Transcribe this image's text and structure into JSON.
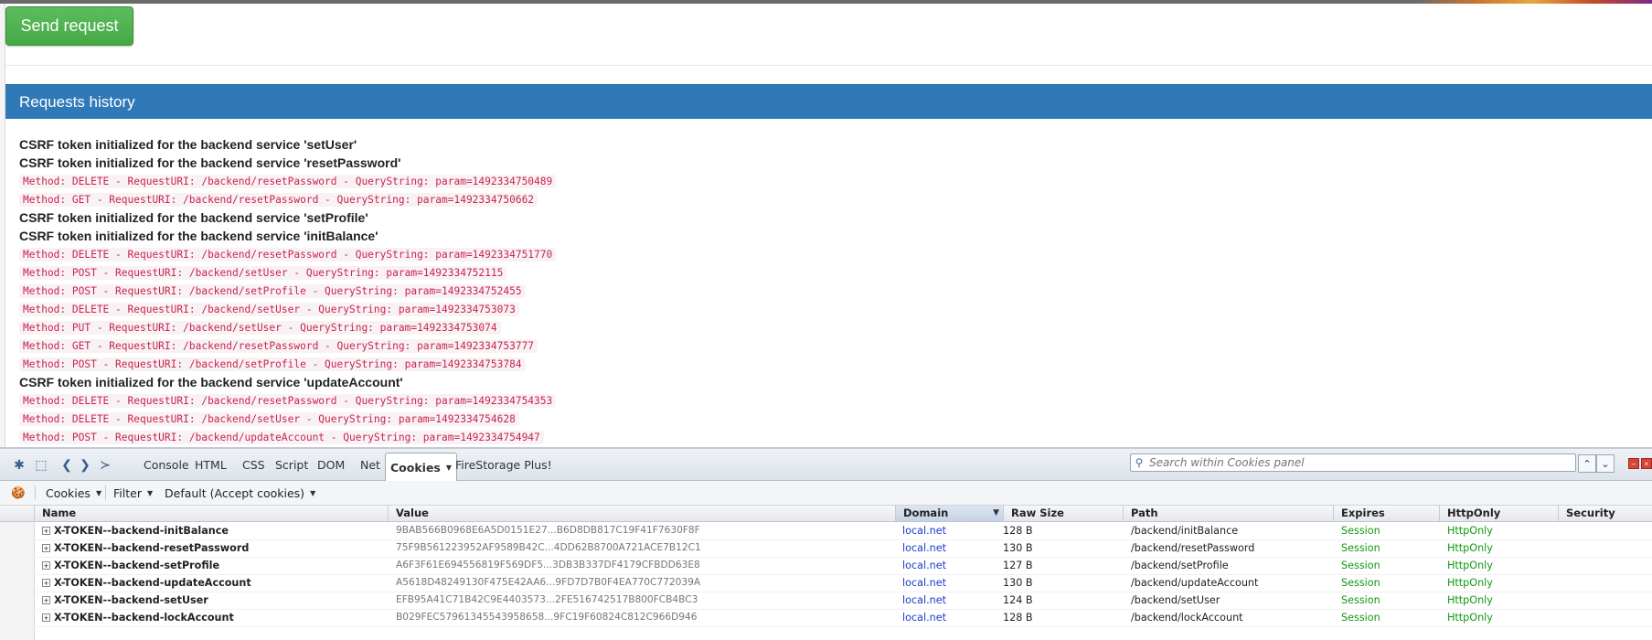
{
  "send_button": {
    "label": "Send request",
    "color": "#4cae4c"
  },
  "history": {
    "title": "Requests history",
    "header_color": "#3079b8",
    "entries": [
      {
        "kind": "csrf",
        "text": "CSRF token initialized for the backend service 'setUser'"
      },
      {
        "kind": "csrf",
        "text": "CSRF token initialized for the backend service 'resetPassword'"
      },
      {
        "kind": "req",
        "text": "Method: DELETE - RequestURI: /backend/resetPassword - QueryString: param=1492334750489"
      },
      {
        "kind": "req",
        "text": "Method: GET - RequestURI: /backend/resetPassword - QueryString: param=1492334750662"
      },
      {
        "kind": "csrf",
        "text": "CSRF token initialized for the backend service 'setProfile'"
      },
      {
        "kind": "csrf",
        "text": "CSRF token initialized for the backend service 'initBalance'"
      },
      {
        "kind": "req",
        "text": "Method: DELETE - RequestURI: /backend/resetPassword - QueryString: param=1492334751770"
      },
      {
        "kind": "req",
        "text": "Method: POST - RequestURI: /backend/setUser - QueryString: param=1492334752115"
      },
      {
        "kind": "req",
        "text": "Method: POST - RequestURI: /backend/setProfile - QueryString: param=1492334752455"
      },
      {
        "kind": "req",
        "text": "Method: DELETE - RequestURI: /backend/setUser - QueryString: param=1492334753073"
      },
      {
        "kind": "req",
        "text": "Method: PUT - RequestURI: /backend/setUser - QueryString: param=1492334753074"
      },
      {
        "kind": "req",
        "text": "Method: GET - RequestURI: /backend/resetPassword - QueryString: param=1492334753777"
      },
      {
        "kind": "req",
        "text": "Method: POST - RequestURI: /backend/setProfile - QueryString: param=1492334753784"
      },
      {
        "kind": "csrf",
        "text": "CSRF token initialized for the backend service 'updateAccount'"
      },
      {
        "kind": "req",
        "text": "Method: DELETE - RequestURI: /backend/resetPassword - QueryString: param=1492334754353"
      },
      {
        "kind": "req",
        "text": "Method: DELETE - RequestURI: /backend/setUser - QueryString: param=1492334754628"
      },
      {
        "kind": "req",
        "text": "Method: POST - RequestURI: /backend/updateAccount - QueryString: param=1492334754947"
      }
    ]
  },
  "firebug": {
    "tools": [
      {
        "name": "firebug-menu-icon",
        "glyph": "✱"
      },
      {
        "name": "inspect-icon",
        "glyph": "⬚"
      },
      {
        "name": "back-icon",
        "glyph": "❮"
      },
      {
        "name": "forward-icon",
        "glyph": "❯"
      },
      {
        "name": "command-line-icon",
        "glyph": "≻"
      }
    ],
    "tabs": [
      {
        "label": "Console",
        "active": false
      },
      {
        "label": "HTML",
        "active": false
      },
      {
        "label": "CSS",
        "active": false
      },
      {
        "label": "Script",
        "active": false
      },
      {
        "label": "DOM",
        "active": false
      },
      {
        "label": "Net",
        "active": false
      },
      {
        "label": "Cookies",
        "active": true
      },
      {
        "label": "FireStorage Plus!",
        "active": false
      }
    ],
    "search_placeholder": "Search within Cookies panel",
    "subtoolbar": {
      "cookies_menu": "Cookies",
      "filter_menu": "Filter",
      "default_menu": "Default (Accept cookies)"
    },
    "columns": [
      "Name",
      "Value",
      "Domain",
      "Raw Size",
      "Path",
      "Expires",
      "HttpOnly",
      "Security"
    ],
    "sorted_column": "Domain",
    "rows": [
      {
        "name": "X-TOKEN--backend-initBalance",
        "value": "9BAB566B0968E6A5D0151E27...B6D8DB817C19F41F7630F8F",
        "domain": "local.net",
        "size": "128 B",
        "path": "/backend/initBalance",
        "expires": "Session",
        "httponly": "HttpOnly",
        "security": ""
      },
      {
        "name": "X-TOKEN--backend-resetPassword",
        "value": "75F9B561223952AF9589B42C...4DD62B8700A721ACE7B12C1",
        "domain": "local.net",
        "size": "130 B",
        "path": "/backend/resetPassword",
        "expires": "Session",
        "httponly": "HttpOnly",
        "security": ""
      },
      {
        "name": "X-TOKEN--backend-setProfile",
        "value": "A6F3F61E694556819F569DF5...3DB3B337DF4179CFBDD63E8",
        "domain": "local.net",
        "size": "127 B",
        "path": "/backend/setProfile",
        "expires": "Session",
        "httponly": "HttpOnly",
        "security": ""
      },
      {
        "name": "X-TOKEN--backend-updateAccount",
        "value": "A5618D48249130F475E42AA6...9FD7D7B0F4EA770C772039A",
        "domain": "local.net",
        "size": "130 B",
        "path": "/backend/updateAccount",
        "expires": "Session",
        "httponly": "HttpOnly",
        "security": ""
      },
      {
        "name": "X-TOKEN--backend-setUser",
        "value": "EFB95A41C71B42C9E4403573...2FE516742517B800FCB4BC3",
        "domain": "local.net",
        "size": "124 B",
        "path": "/backend/setUser",
        "expires": "Session",
        "httponly": "HttpOnly",
        "security": ""
      },
      {
        "name": "X-TOKEN--backend-lockAccount",
        "value": "B029FEC57961345543958658...9FC19F60824C812C966D946",
        "domain": "local.net",
        "size": "128 B",
        "path": "/backend/lockAccount",
        "expires": "Session",
        "httponly": "HttpOnly",
        "security": ""
      }
    ]
  }
}
